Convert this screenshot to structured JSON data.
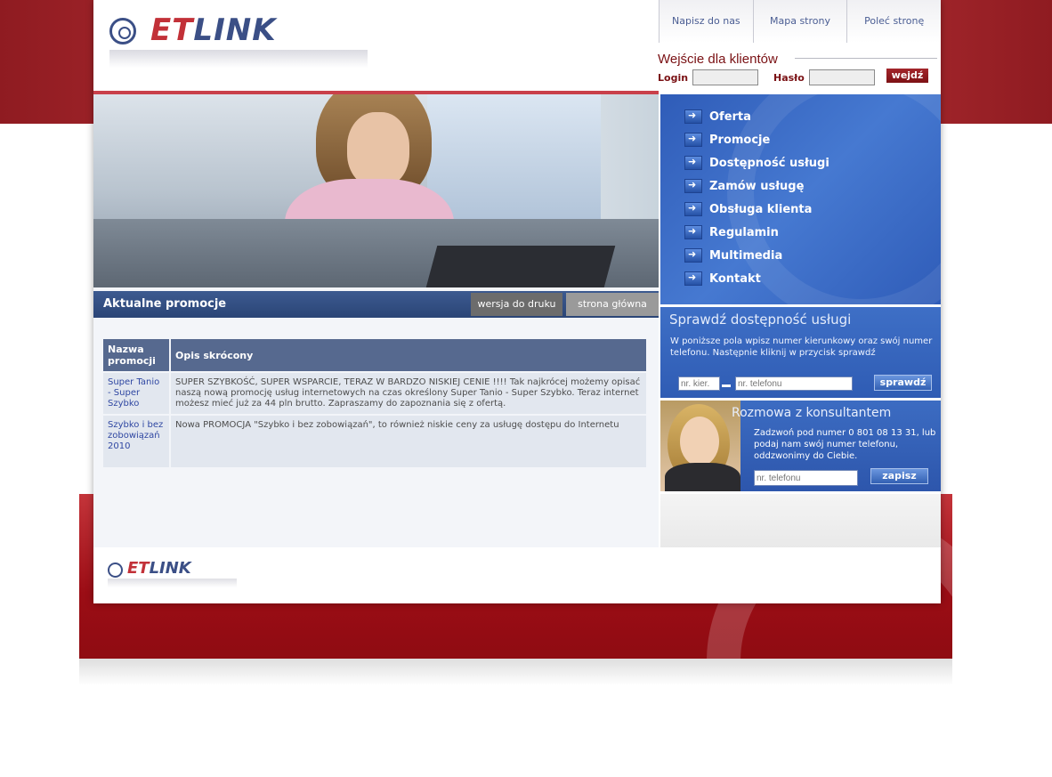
{
  "brand": {
    "logo_part1": "ET",
    "logo_part2": "LINK"
  },
  "header": {
    "top_links": [
      "Napisz do nas",
      "Mapa strony",
      "Poleć stronę"
    ],
    "login": {
      "title": "Wejście dla klientów",
      "login_label": "Login",
      "password_label": "Hasło",
      "submit_label": "wejdź"
    }
  },
  "nav": {
    "items": [
      "Oferta",
      "Promocje",
      "Dostępność usługi",
      "Zamów usługę",
      "Obsługa klienta",
      "Regulamin",
      "Multimedia",
      "Kontakt"
    ]
  },
  "availability": {
    "title": "Sprawdź dostępność usługi",
    "description": "W poniższe pola wpisz numer kierunkowy oraz swój numer telefonu. Następnie kliknij w przycisk sprawdź",
    "area_placeholder": "nr. kier.",
    "phone_placeholder": "nr. telefonu",
    "button_label": "sprawdź"
  },
  "consultant": {
    "title": "Rozmowa z konsultantem",
    "description": "Zadzwoń pod numer 0 801 08 13 31, lub podaj nam swój numer telefonu, oddzwonimy do Ciebie.",
    "phone_placeholder": "nr. telefonu",
    "button_label": "zapisz"
  },
  "main": {
    "title": "Aktualne promocje",
    "print_label": "wersja do druku",
    "home_label": "strona główna",
    "table": {
      "headers": [
        "Nazwa promocji",
        "Opis skrócony"
      ],
      "rows": [
        {
          "name": "Super Tanio - Super Szybko",
          "description": "SUPER SZYBKOŚĆ, SUPER WSPARCIE, TERAZ W BARDZO NISKIEJ CENIE !!!! Tak najkrócej możemy opisać naszą nową promocję usług internetowych na czas określony Super Tanio - Super Szybko. Teraz internet możesz mieć już za 44 pln brutto. Zapraszamy do zapoznania się z ofertą."
        },
        {
          "name": "Szybko i bez zobowiązań 2010",
          "description": "Nowa PROMOCJA \"Szybko i bez zobowiązań\", to również niskie ceny za usługę dostępu do Internetu"
        }
      ]
    }
  },
  "colors": {
    "brand_red": "#c23138",
    "brand_blue": "#3b4f86",
    "nav_blue": "#3e6fc6"
  }
}
